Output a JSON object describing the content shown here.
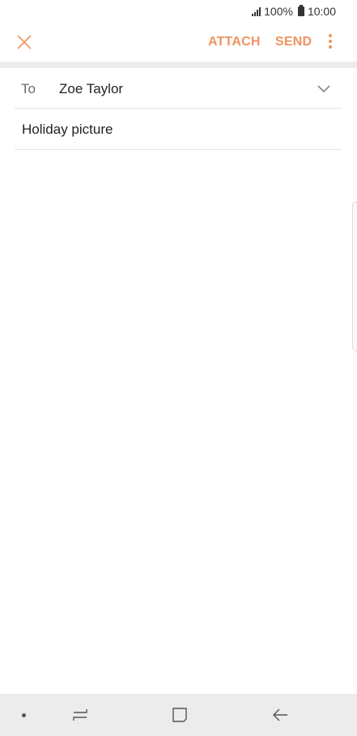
{
  "status_bar": {
    "battery_percent": "100%",
    "time": "10:00",
    "icons": [
      "signal-icon",
      "battery-icon"
    ]
  },
  "action_bar": {
    "close_icon": "close-icon",
    "attach_label": "ATTACH",
    "send_label": "SEND",
    "more_icon": "more-vert-icon",
    "accent_color": "#f0935f"
  },
  "compose": {
    "to_label": "To",
    "to_value": "Zoe Taylor",
    "expand_icon": "chevron-down-icon",
    "subject_value": "Holiday picture",
    "body_value": ""
  },
  "nav_bar": {
    "icons": [
      "nav-dot-icon",
      "recents-icon",
      "home-icon",
      "back-icon"
    ]
  }
}
